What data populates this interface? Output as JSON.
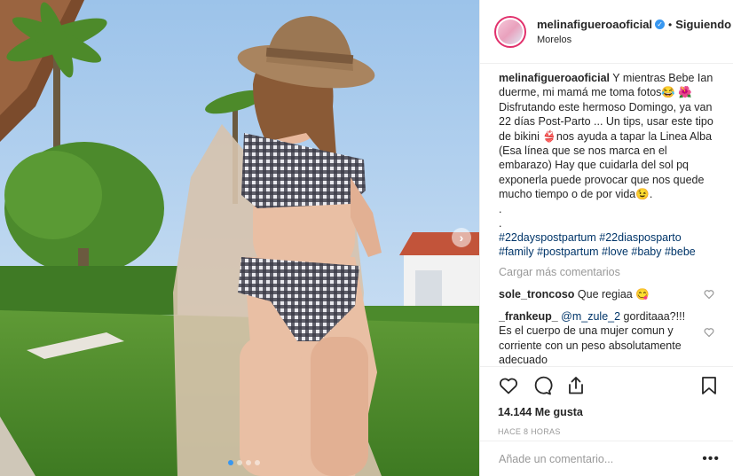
{
  "header": {
    "username": "melinafigueroaoficial",
    "separator": "•",
    "follow_label": "Siguiendo",
    "location": "Morelos"
  },
  "caption": {
    "username": "melinafigueroaoficial",
    "text": " Y mientras Bebe Ian duerme, mi mamá me toma fotos😂 🌺 Disfrutando este hermoso Domingo, ya van 22 días Post-Parto ... Un tips, usar este tipo de bikini 👙nos ayuda a tapar la Linea Alba (Esa línea que se nos marca en el embarazo) Hay que cuidarla del sol pq exponerla puede provocar que nos quede mucho tiempo o de por vida😉.",
    "dot1": ".",
    "dot2": ".",
    "hashtags": [
      "#22dayspostpartum",
      "#22diasposparto",
      "#family",
      "#postpartum",
      "#love",
      "#baby",
      "#bebe"
    ]
  },
  "load_more": "Cargar más comentarios",
  "comments": [
    {
      "username": "sole_troncoso",
      "text": " Que regiaa 😋"
    },
    {
      "username": "_frankeup_",
      "mention": " @m_zule_2",
      "text": " gorditaaa?!!! Es el cuerpo de una mujer comun y corriente con un peso absolutamente adecuado"
    }
  ],
  "likes": "14.144 Me gusta",
  "time": "HACE 8 HORAS",
  "add_comment": {
    "placeholder": "Añade un comentario..."
  },
  "more_options": "•••",
  "icons": [
    "heart-icon",
    "comment-icon",
    "share-icon",
    "bookmark-icon",
    "verified-icon",
    "chevron-right-icon"
  ],
  "colors": {
    "accent": "#3897f0",
    "hashtag": "#003569",
    "muted": "#999999"
  }
}
